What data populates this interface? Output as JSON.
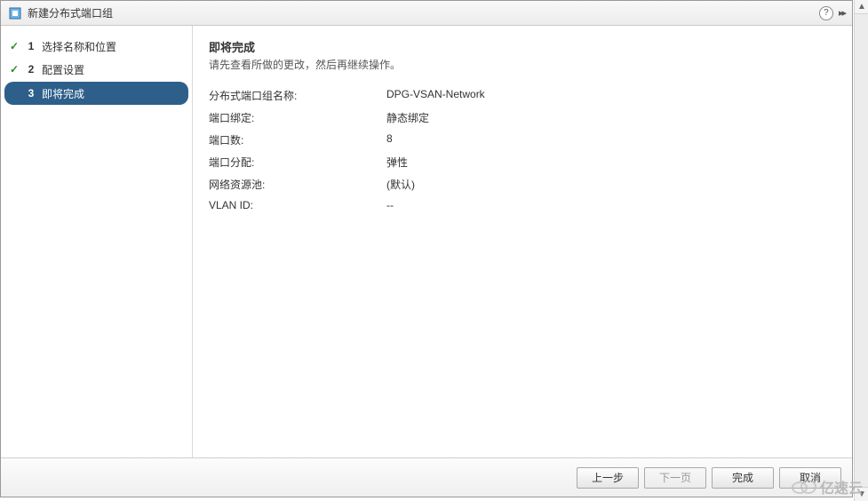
{
  "dialog": {
    "title": "新建分布式端口组"
  },
  "sidebar": {
    "steps": [
      {
        "num": "1",
        "label": "选择名称和位置",
        "done": true
      },
      {
        "num": "2",
        "label": "配置设置",
        "done": true
      },
      {
        "num": "3",
        "label": "即将完成",
        "active": true
      }
    ]
  },
  "content": {
    "heading": "即将完成",
    "subtitle": "请先查看所做的更改，然后再继续操作。",
    "rows": [
      {
        "label": "分布式端口组名称:",
        "value": "DPG-VSAN-Network"
      },
      {
        "label": "端口绑定:",
        "value": "静态绑定"
      },
      {
        "label": "端口数:",
        "value": "8"
      },
      {
        "label": "端口分配:",
        "value": "弹性"
      },
      {
        "label": "网络资源池:",
        "value": "(默认)"
      },
      {
        "label": "VLAN ID:",
        "value": "--"
      }
    ]
  },
  "footer": {
    "back": "上一步",
    "next": "下一页",
    "finish": "完成",
    "cancel": "取消"
  },
  "watermark": "亿速云"
}
